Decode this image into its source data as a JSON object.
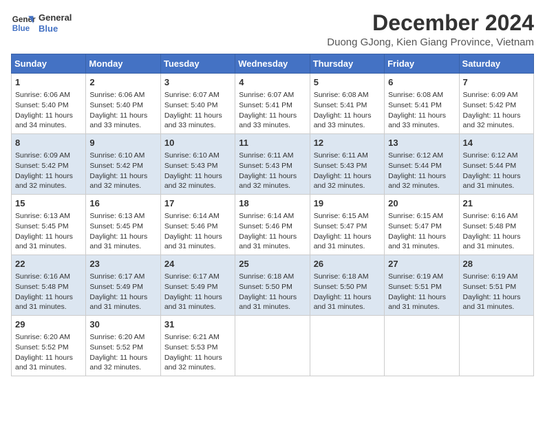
{
  "logo": {
    "line1": "General",
    "line2": "Blue"
  },
  "title": "December 2024",
  "subtitle": "Duong GJong, Kien Giang Province, Vietnam",
  "days_header": [
    "Sunday",
    "Monday",
    "Tuesday",
    "Wednesday",
    "Thursday",
    "Friday",
    "Saturday"
  ],
  "weeks": [
    [
      {
        "day": "1",
        "sunrise": "6:06 AM",
        "sunset": "5:40 PM",
        "daylight": "11 hours and 34 minutes."
      },
      {
        "day": "2",
        "sunrise": "6:06 AM",
        "sunset": "5:40 PM",
        "daylight": "11 hours and 33 minutes."
      },
      {
        "day": "3",
        "sunrise": "6:07 AM",
        "sunset": "5:40 PM",
        "daylight": "11 hours and 33 minutes."
      },
      {
        "day": "4",
        "sunrise": "6:07 AM",
        "sunset": "5:41 PM",
        "daylight": "11 hours and 33 minutes."
      },
      {
        "day": "5",
        "sunrise": "6:08 AM",
        "sunset": "5:41 PM",
        "daylight": "11 hours and 33 minutes."
      },
      {
        "day": "6",
        "sunrise": "6:08 AM",
        "sunset": "5:41 PM",
        "daylight": "11 hours and 33 minutes."
      },
      {
        "day": "7",
        "sunrise": "6:09 AM",
        "sunset": "5:42 PM",
        "daylight": "11 hours and 32 minutes."
      }
    ],
    [
      {
        "day": "8",
        "sunrise": "6:09 AM",
        "sunset": "5:42 PM",
        "daylight": "11 hours and 32 minutes."
      },
      {
        "day": "9",
        "sunrise": "6:10 AM",
        "sunset": "5:42 PM",
        "daylight": "11 hours and 32 minutes."
      },
      {
        "day": "10",
        "sunrise": "6:10 AM",
        "sunset": "5:43 PM",
        "daylight": "11 hours and 32 minutes."
      },
      {
        "day": "11",
        "sunrise": "6:11 AM",
        "sunset": "5:43 PM",
        "daylight": "11 hours and 32 minutes."
      },
      {
        "day": "12",
        "sunrise": "6:11 AM",
        "sunset": "5:43 PM",
        "daylight": "11 hours and 32 minutes."
      },
      {
        "day": "13",
        "sunrise": "6:12 AM",
        "sunset": "5:44 PM",
        "daylight": "11 hours and 32 minutes."
      },
      {
        "day": "14",
        "sunrise": "6:12 AM",
        "sunset": "5:44 PM",
        "daylight": "11 hours and 31 minutes."
      }
    ],
    [
      {
        "day": "15",
        "sunrise": "6:13 AM",
        "sunset": "5:45 PM",
        "daylight": "11 hours and 31 minutes."
      },
      {
        "day": "16",
        "sunrise": "6:13 AM",
        "sunset": "5:45 PM",
        "daylight": "11 hours and 31 minutes."
      },
      {
        "day": "17",
        "sunrise": "6:14 AM",
        "sunset": "5:46 PM",
        "daylight": "11 hours and 31 minutes."
      },
      {
        "day": "18",
        "sunrise": "6:14 AM",
        "sunset": "5:46 PM",
        "daylight": "11 hours and 31 minutes."
      },
      {
        "day": "19",
        "sunrise": "6:15 AM",
        "sunset": "5:47 PM",
        "daylight": "11 hours and 31 minutes."
      },
      {
        "day": "20",
        "sunrise": "6:15 AM",
        "sunset": "5:47 PM",
        "daylight": "11 hours and 31 minutes."
      },
      {
        "day": "21",
        "sunrise": "6:16 AM",
        "sunset": "5:48 PM",
        "daylight": "11 hours and 31 minutes."
      }
    ],
    [
      {
        "day": "22",
        "sunrise": "6:16 AM",
        "sunset": "5:48 PM",
        "daylight": "11 hours and 31 minutes."
      },
      {
        "day": "23",
        "sunrise": "6:17 AM",
        "sunset": "5:49 PM",
        "daylight": "11 hours and 31 minutes."
      },
      {
        "day": "24",
        "sunrise": "6:17 AM",
        "sunset": "5:49 PM",
        "daylight": "11 hours and 31 minutes."
      },
      {
        "day": "25",
        "sunrise": "6:18 AM",
        "sunset": "5:50 PM",
        "daylight": "11 hours and 31 minutes."
      },
      {
        "day": "26",
        "sunrise": "6:18 AM",
        "sunset": "5:50 PM",
        "daylight": "11 hours and 31 minutes."
      },
      {
        "day": "27",
        "sunrise": "6:19 AM",
        "sunset": "5:51 PM",
        "daylight": "11 hours and 31 minutes."
      },
      {
        "day": "28",
        "sunrise": "6:19 AM",
        "sunset": "5:51 PM",
        "daylight": "11 hours and 31 minutes."
      }
    ],
    [
      {
        "day": "29",
        "sunrise": "6:20 AM",
        "sunset": "5:52 PM",
        "daylight": "11 hours and 31 minutes."
      },
      {
        "day": "30",
        "sunrise": "6:20 AM",
        "sunset": "5:52 PM",
        "daylight": "11 hours and 32 minutes."
      },
      {
        "day": "31",
        "sunrise": "6:21 AM",
        "sunset": "5:53 PM",
        "daylight": "11 hours and 32 minutes."
      },
      null,
      null,
      null,
      null
    ]
  ]
}
